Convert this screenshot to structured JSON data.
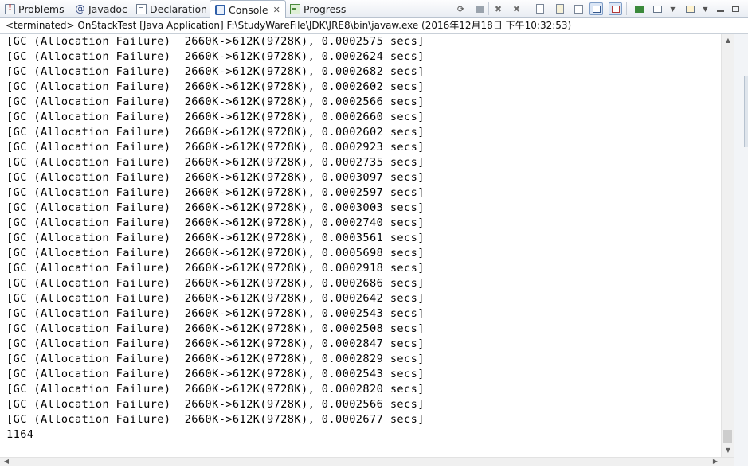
{
  "tabs": [
    {
      "label": "Problems",
      "icon": "problems-icon",
      "active": false
    },
    {
      "label": "Javadoc",
      "icon": "javadoc-icon",
      "active": false
    },
    {
      "label": "Declaration",
      "icon": "declaration-icon",
      "active": false
    },
    {
      "label": "Console",
      "icon": "console-icon",
      "active": true,
      "close": "✕"
    },
    {
      "label": "Progress",
      "icon": "progress-icon",
      "active": false
    }
  ],
  "toolbar": {
    "icons": [
      "terminate-relaunch-icon",
      "terminate-icon",
      "remove-launch-icon",
      "remove-all-terminated-icon",
      "clear-console-icon",
      "scroll-lock-icon",
      "word-wrap-icon",
      "show-stdout-icon",
      "show-stderr-icon",
      "pin-console-icon",
      "display-selected-console-icon",
      "open-console-icon",
      "minimize-icon",
      "maximize-icon"
    ]
  },
  "status": "<terminated> OnStackTest [Java Application] F:\\StudyWareFile\\JDK\\JRE8\\bin\\javaw.exe (2016年12月18日 下午10:32:53)",
  "console": {
    "lines": [
      "[GC (Allocation Failure)  2660K->612K(9728K), 0.0002575 secs]",
      "[GC (Allocation Failure)  2660K->612K(9728K), 0.0002624 secs]",
      "[GC (Allocation Failure)  2660K->612K(9728K), 0.0002682 secs]",
      "[GC (Allocation Failure)  2660K->612K(9728K), 0.0002602 secs]",
      "[GC (Allocation Failure)  2660K->612K(9728K), 0.0002566 secs]",
      "[GC (Allocation Failure)  2660K->612K(9728K), 0.0002660 secs]",
      "[GC (Allocation Failure)  2660K->612K(9728K), 0.0002602 secs]",
      "[GC (Allocation Failure)  2660K->612K(9728K), 0.0002923 secs]",
      "[GC (Allocation Failure)  2660K->612K(9728K), 0.0002735 secs]",
      "[GC (Allocation Failure)  2660K->612K(9728K), 0.0003097 secs]",
      "[GC (Allocation Failure)  2660K->612K(9728K), 0.0002597 secs]",
      "[GC (Allocation Failure)  2660K->612K(9728K), 0.0003003 secs]",
      "[GC (Allocation Failure)  2660K->612K(9728K), 0.0002740 secs]",
      "[GC (Allocation Failure)  2660K->612K(9728K), 0.0003561 secs]",
      "[GC (Allocation Failure)  2660K->612K(9728K), 0.0005698 secs]",
      "[GC (Allocation Failure)  2660K->612K(9728K), 0.0002918 secs]",
      "[GC (Allocation Failure)  2660K->612K(9728K), 0.0002686 secs]",
      "[GC (Allocation Failure)  2660K->612K(9728K), 0.0002642 secs]",
      "[GC (Allocation Failure)  2660K->612K(9728K), 0.0002543 secs]",
      "[GC (Allocation Failure)  2660K->612K(9728K), 0.0002508 secs]",
      "[GC (Allocation Failure)  2660K->612K(9728K), 0.0002847 secs]",
      "[GC (Allocation Failure)  2660K->612K(9728K), 0.0002829 secs]",
      "[GC (Allocation Failure)  2660K->612K(9728K), 0.0002543 secs]",
      "[GC (Allocation Failure)  2660K->612K(9728K), 0.0002820 secs]",
      "[GC (Allocation Failure)  2660K->612K(9728K), 0.0002566 secs]",
      "[GC (Allocation Failure)  2660K->612K(9728K), 0.0002677 secs]",
      "1164"
    ]
  }
}
